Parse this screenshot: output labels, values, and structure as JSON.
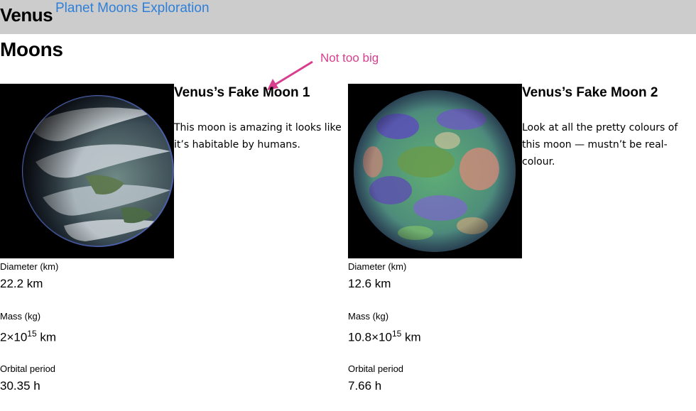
{
  "header": {
    "title": "Venus",
    "subtitle_link": "Planet Moons Exploration"
  },
  "section": {
    "title": "Moons"
  },
  "annotation": {
    "text": "Not too big",
    "color": "#d83e8e"
  },
  "moons": [
    {
      "name": "Venus’s Fake Moon 1",
      "description": "This moon is amazing it looks like it’s habitable by humans.",
      "stats": {
        "diameter_label": "Diameter (km)",
        "diameter_value": "22.2 km",
        "mass_label": "Mass (kg)",
        "mass_base": "2×10",
        "mass_exp": "15",
        "mass_unit": " km",
        "orbital_label": "Orbital period",
        "orbital_value": "30.35 h"
      }
    },
    {
      "name": "Venus’s Fake Moon 2",
      "description": "Look at all the pretty colours of this moon — mustn’t be real-colour.",
      "stats": {
        "diameter_label": "Diameter (km)",
        "diameter_value": "12.6 km",
        "mass_label": "Mass (kg)",
        "mass_base": "10.8×10",
        "mass_exp": "15",
        "mass_unit": " km",
        "orbital_label": "Orbital period",
        "orbital_value": "7.66 h"
      }
    }
  ],
  "colors": {
    "header_bg": "#cccccc",
    "link": "#2f7fd8"
  }
}
